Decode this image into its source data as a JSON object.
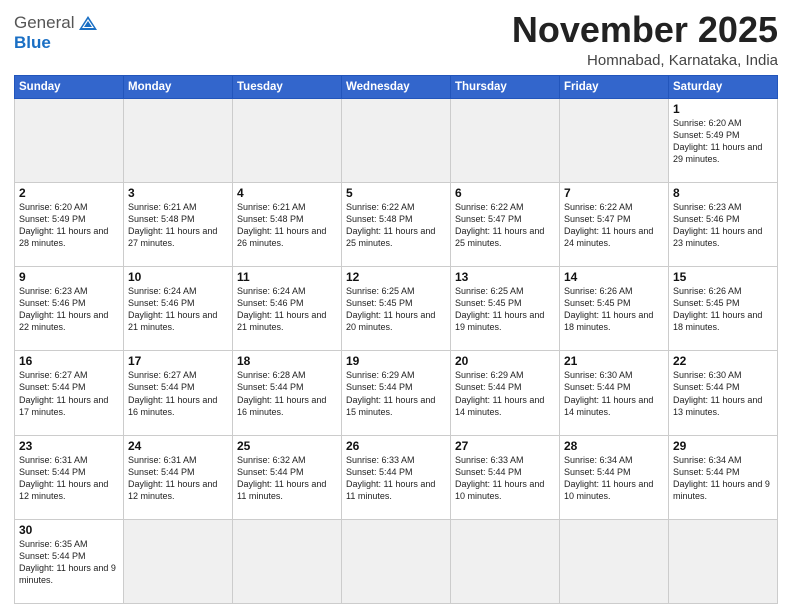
{
  "logo": {
    "general": "General",
    "blue": "Blue"
  },
  "header": {
    "month_year": "November 2025",
    "location": "Homnabad, Karnataka, India"
  },
  "days_of_week": [
    "Sunday",
    "Monday",
    "Tuesday",
    "Wednesday",
    "Thursday",
    "Friday",
    "Saturday"
  ],
  "weeks": [
    [
      {
        "day": "",
        "empty": true
      },
      {
        "day": "",
        "empty": true
      },
      {
        "day": "",
        "empty": true
      },
      {
        "day": "",
        "empty": true
      },
      {
        "day": "",
        "empty": true
      },
      {
        "day": "",
        "empty": true
      },
      {
        "day": "1",
        "sunrise": "Sunrise: 6:20 AM",
        "sunset": "Sunset: 5:49 PM",
        "daylight": "Daylight: 11 hours and 29 minutes."
      }
    ],
    [
      {
        "day": "2",
        "sunrise": "Sunrise: 6:20 AM",
        "sunset": "Sunset: 5:49 PM",
        "daylight": "Daylight: 11 hours and 28 minutes."
      },
      {
        "day": "3",
        "sunrise": "Sunrise: 6:21 AM",
        "sunset": "Sunset: 5:48 PM",
        "daylight": "Daylight: 11 hours and 27 minutes."
      },
      {
        "day": "4",
        "sunrise": "Sunrise: 6:21 AM",
        "sunset": "Sunset: 5:48 PM",
        "daylight": "Daylight: 11 hours and 26 minutes."
      },
      {
        "day": "5",
        "sunrise": "Sunrise: 6:22 AM",
        "sunset": "Sunset: 5:48 PM",
        "daylight": "Daylight: 11 hours and 25 minutes."
      },
      {
        "day": "6",
        "sunrise": "Sunrise: 6:22 AM",
        "sunset": "Sunset: 5:47 PM",
        "daylight": "Daylight: 11 hours and 25 minutes."
      },
      {
        "day": "7",
        "sunrise": "Sunrise: 6:22 AM",
        "sunset": "Sunset: 5:47 PM",
        "daylight": "Daylight: 11 hours and 24 minutes."
      },
      {
        "day": "8",
        "sunrise": "Sunrise: 6:23 AM",
        "sunset": "Sunset: 5:46 PM",
        "daylight": "Daylight: 11 hours and 23 minutes."
      }
    ],
    [
      {
        "day": "9",
        "sunrise": "Sunrise: 6:23 AM",
        "sunset": "Sunset: 5:46 PM",
        "daylight": "Daylight: 11 hours and 22 minutes."
      },
      {
        "day": "10",
        "sunrise": "Sunrise: 6:24 AM",
        "sunset": "Sunset: 5:46 PM",
        "daylight": "Daylight: 11 hours and 21 minutes."
      },
      {
        "day": "11",
        "sunrise": "Sunrise: 6:24 AM",
        "sunset": "Sunset: 5:46 PM",
        "daylight": "Daylight: 11 hours and 21 minutes."
      },
      {
        "day": "12",
        "sunrise": "Sunrise: 6:25 AM",
        "sunset": "Sunset: 5:45 PM",
        "daylight": "Daylight: 11 hours and 20 minutes."
      },
      {
        "day": "13",
        "sunrise": "Sunrise: 6:25 AM",
        "sunset": "Sunset: 5:45 PM",
        "daylight": "Daylight: 11 hours and 19 minutes."
      },
      {
        "day": "14",
        "sunrise": "Sunrise: 6:26 AM",
        "sunset": "Sunset: 5:45 PM",
        "daylight": "Daylight: 11 hours and 18 minutes."
      },
      {
        "day": "15",
        "sunrise": "Sunrise: 6:26 AM",
        "sunset": "Sunset: 5:45 PM",
        "daylight": "Daylight: 11 hours and 18 minutes."
      }
    ],
    [
      {
        "day": "16",
        "sunrise": "Sunrise: 6:27 AM",
        "sunset": "Sunset: 5:44 PM",
        "daylight": "Daylight: 11 hours and 17 minutes."
      },
      {
        "day": "17",
        "sunrise": "Sunrise: 6:27 AM",
        "sunset": "Sunset: 5:44 PM",
        "daylight": "Daylight: 11 hours and 16 minutes."
      },
      {
        "day": "18",
        "sunrise": "Sunrise: 6:28 AM",
        "sunset": "Sunset: 5:44 PM",
        "daylight": "Daylight: 11 hours and 16 minutes."
      },
      {
        "day": "19",
        "sunrise": "Sunrise: 6:29 AM",
        "sunset": "Sunset: 5:44 PM",
        "daylight": "Daylight: 11 hours and 15 minutes."
      },
      {
        "day": "20",
        "sunrise": "Sunrise: 6:29 AM",
        "sunset": "Sunset: 5:44 PM",
        "daylight": "Daylight: 11 hours and 14 minutes."
      },
      {
        "day": "21",
        "sunrise": "Sunrise: 6:30 AM",
        "sunset": "Sunset: 5:44 PM",
        "daylight": "Daylight: 11 hours and 14 minutes."
      },
      {
        "day": "22",
        "sunrise": "Sunrise: 6:30 AM",
        "sunset": "Sunset: 5:44 PM",
        "daylight": "Daylight: 11 hours and 13 minutes."
      }
    ],
    [
      {
        "day": "23",
        "sunrise": "Sunrise: 6:31 AM",
        "sunset": "Sunset: 5:44 PM",
        "daylight": "Daylight: 11 hours and 12 minutes."
      },
      {
        "day": "24",
        "sunrise": "Sunrise: 6:31 AM",
        "sunset": "Sunset: 5:44 PM",
        "daylight": "Daylight: 11 hours and 12 minutes."
      },
      {
        "day": "25",
        "sunrise": "Sunrise: 6:32 AM",
        "sunset": "Sunset: 5:44 PM",
        "daylight": "Daylight: 11 hours and 11 minutes."
      },
      {
        "day": "26",
        "sunrise": "Sunrise: 6:33 AM",
        "sunset": "Sunset: 5:44 PM",
        "daylight": "Daylight: 11 hours and 11 minutes."
      },
      {
        "day": "27",
        "sunrise": "Sunrise: 6:33 AM",
        "sunset": "Sunset: 5:44 PM",
        "daylight": "Daylight: 11 hours and 10 minutes."
      },
      {
        "day": "28",
        "sunrise": "Sunrise: 6:34 AM",
        "sunset": "Sunset: 5:44 PM",
        "daylight": "Daylight: 11 hours and 10 minutes."
      },
      {
        "day": "29",
        "sunrise": "Sunrise: 6:34 AM",
        "sunset": "Sunset: 5:44 PM",
        "daylight": "Daylight: 11 hours and 9 minutes."
      }
    ],
    [
      {
        "day": "30",
        "sunrise": "Sunrise: 6:35 AM",
        "sunset": "Sunset: 5:44 PM",
        "daylight": "Daylight: 11 hours and 9 minutes."
      },
      {
        "day": "",
        "empty": true
      },
      {
        "day": "",
        "empty": true
      },
      {
        "day": "",
        "empty": true
      },
      {
        "day": "",
        "empty": true
      },
      {
        "day": "",
        "empty": true
      },
      {
        "day": "",
        "empty": true
      }
    ]
  ]
}
